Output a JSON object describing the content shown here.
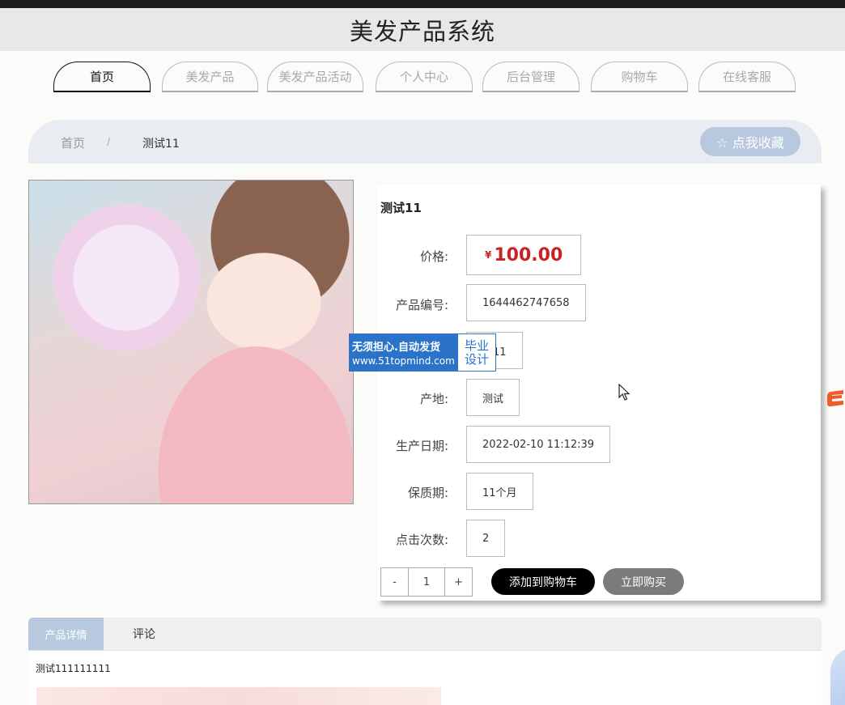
{
  "app_title": "美发产品系统",
  "nav": {
    "items": [
      "首页",
      "美发产品",
      "美发产品活动",
      "个人中心",
      "后台管理",
      "购物车",
      "在线客服"
    ],
    "active": "首页"
  },
  "breadcrumb": {
    "home": "首页",
    "separator": "/",
    "current": "测试11"
  },
  "favorite_button": "☆ 点我收藏",
  "product": {
    "name": "测试11",
    "price_label": "价格:",
    "currency": "¥",
    "price": "100.00",
    "code_label": "产品编号:",
    "code": "1644462747658",
    "type_value": "型11",
    "origin_label": "产地:",
    "origin": "测试",
    "date_label": "生产日期:",
    "date": "2022-02-10 11:12:39",
    "shelf_label": "保质期:",
    "shelf": "11个月",
    "clicks_label": "点击次数:",
    "clicks": "2"
  },
  "quantity": {
    "minus": "-",
    "value": "1",
    "plus": "+"
  },
  "buttons": {
    "add_to_cart": "添加到购物车",
    "buy_now": "立即购买"
  },
  "watermark": {
    "line1": "无须担心.自动发货",
    "line2": "www.51topmind.com",
    "right1": "毕业",
    "right2": "设计"
  },
  "tabs": {
    "detail": "产品详情",
    "comment": "评论"
  },
  "detail_text": "测试111111111",
  "colors": {
    "accent": "#b8c8de",
    "price": "#c82323",
    "watermark": "#2b73c9"
  }
}
